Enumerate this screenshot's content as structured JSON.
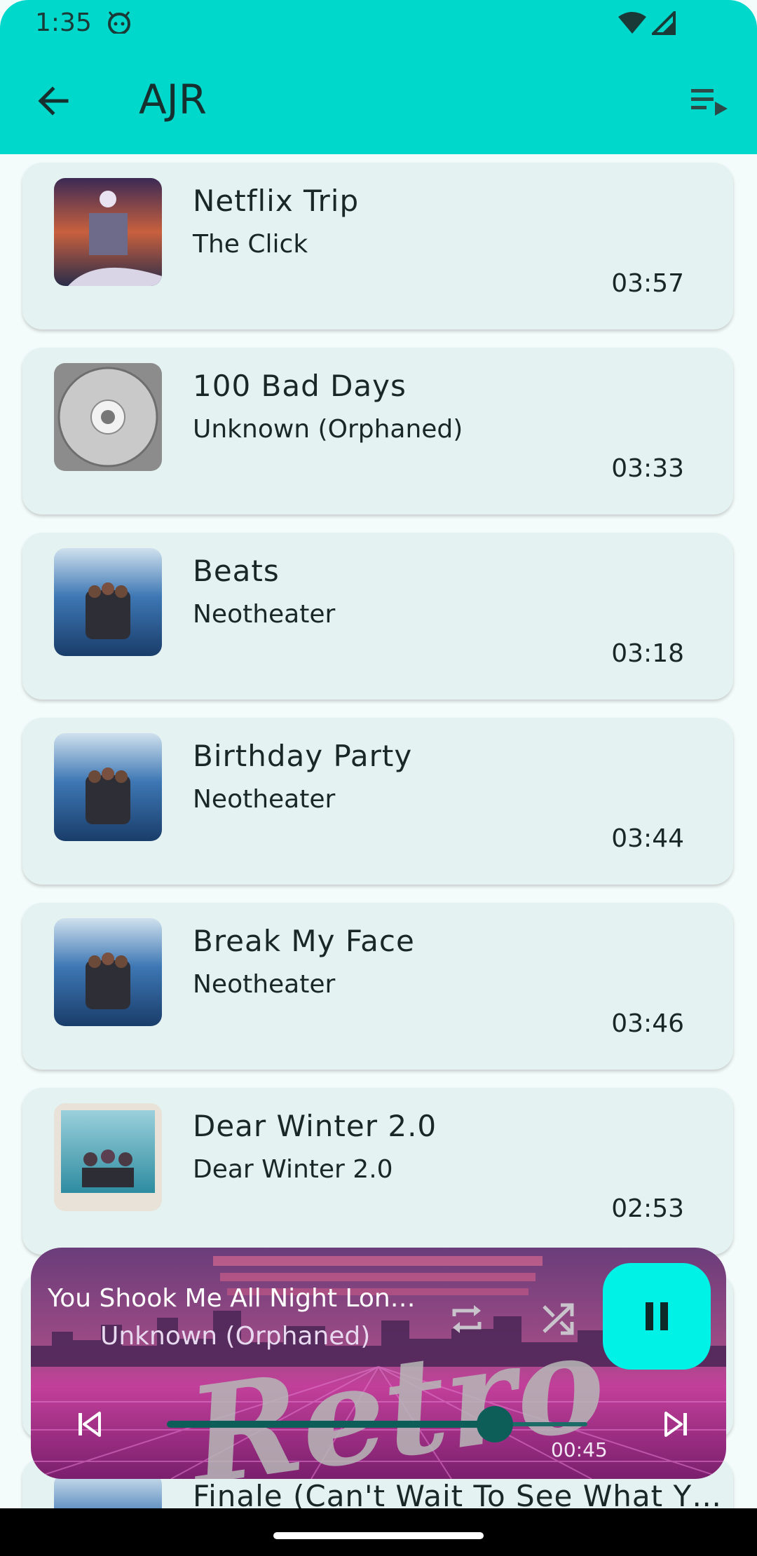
{
  "status_bar": {
    "time": "1:35"
  },
  "app_bar": {
    "title": "AJR"
  },
  "songs": [
    {
      "title": "Netflix Trip",
      "artist": "The Click",
      "duration": "03:57"
    },
    {
      "title": "100 Bad Days",
      "artist": "Unknown (Orphaned)",
      "duration": "03:33"
    },
    {
      "title": "Beats",
      "artist": "Neotheater",
      "duration": "03:18"
    },
    {
      "title": "Birthday Party",
      "artist": "Neotheater",
      "duration": "03:44"
    },
    {
      "title": "Break My Face",
      "artist": "Neotheater",
      "duration": "03:46"
    },
    {
      "title": "Dear Winter 2.0",
      "artist": "Dear Winter 2.0",
      "duration": "02:53"
    },
    {
      "title": "Finale (Can't Wait To See What Y…",
      "artist": "",
      "duration": ""
    }
  ],
  "player": {
    "title": "You Shook Me All Night Lon…",
    "artist": "Unknown (Orphaned)",
    "elapsed": "00:45",
    "progress": 0.78,
    "state": "playing",
    "background_art_text": "Retro"
  },
  "colors": {
    "accent": "#00d8cc",
    "pause_button": "#00f1e6",
    "card": "#e4f3f1",
    "seek": "#0d5e59"
  },
  "icons": [
    "android-icon",
    "wifi-icon",
    "signal-icon",
    "back-arrow-icon",
    "queue-music-icon",
    "repeat-icon",
    "shuffle-icon",
    "pause-icon",
    "skip-previous-icon",
    "skip-next-icon"
  ]
}
